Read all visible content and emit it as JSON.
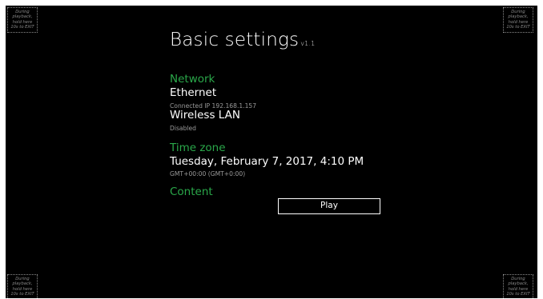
{
  "corner_hint": {
    "line1": "During",
    "line2": "playback,",
    "line3": "hold here",
    "line4": "10s to EXIT"
  },
  "header": {
    "title": "Basic settings",
    "version": "v1.1"
  },
  "network": {
    "heading": "Network",
    "ethernet_label": "Ethernet",
    "ethernet_status": "Connected IP 192.168.1.157",
    "wlan_label": "Wireless LAN",
    "wlan_status": "Disabled"
  },
  "timezone": {
    "heading": "Time zone",
    "datetime": "Tuesday, February 7, 2017, 4:10 PM",
    "offset": "GMT+00:00 (GMT+0:00)"
  },
  "content": {
    "heading": "Content",
    "play_label": "Play"
  },
  "colors": {
    "background": "#000000",
    "accent_green": "#2aa84a",
    "text_primary": "#ffffff",
    "text_secondary": "#9a9a9a",
    "hint_border": "#8a8a8a"
  }
}
